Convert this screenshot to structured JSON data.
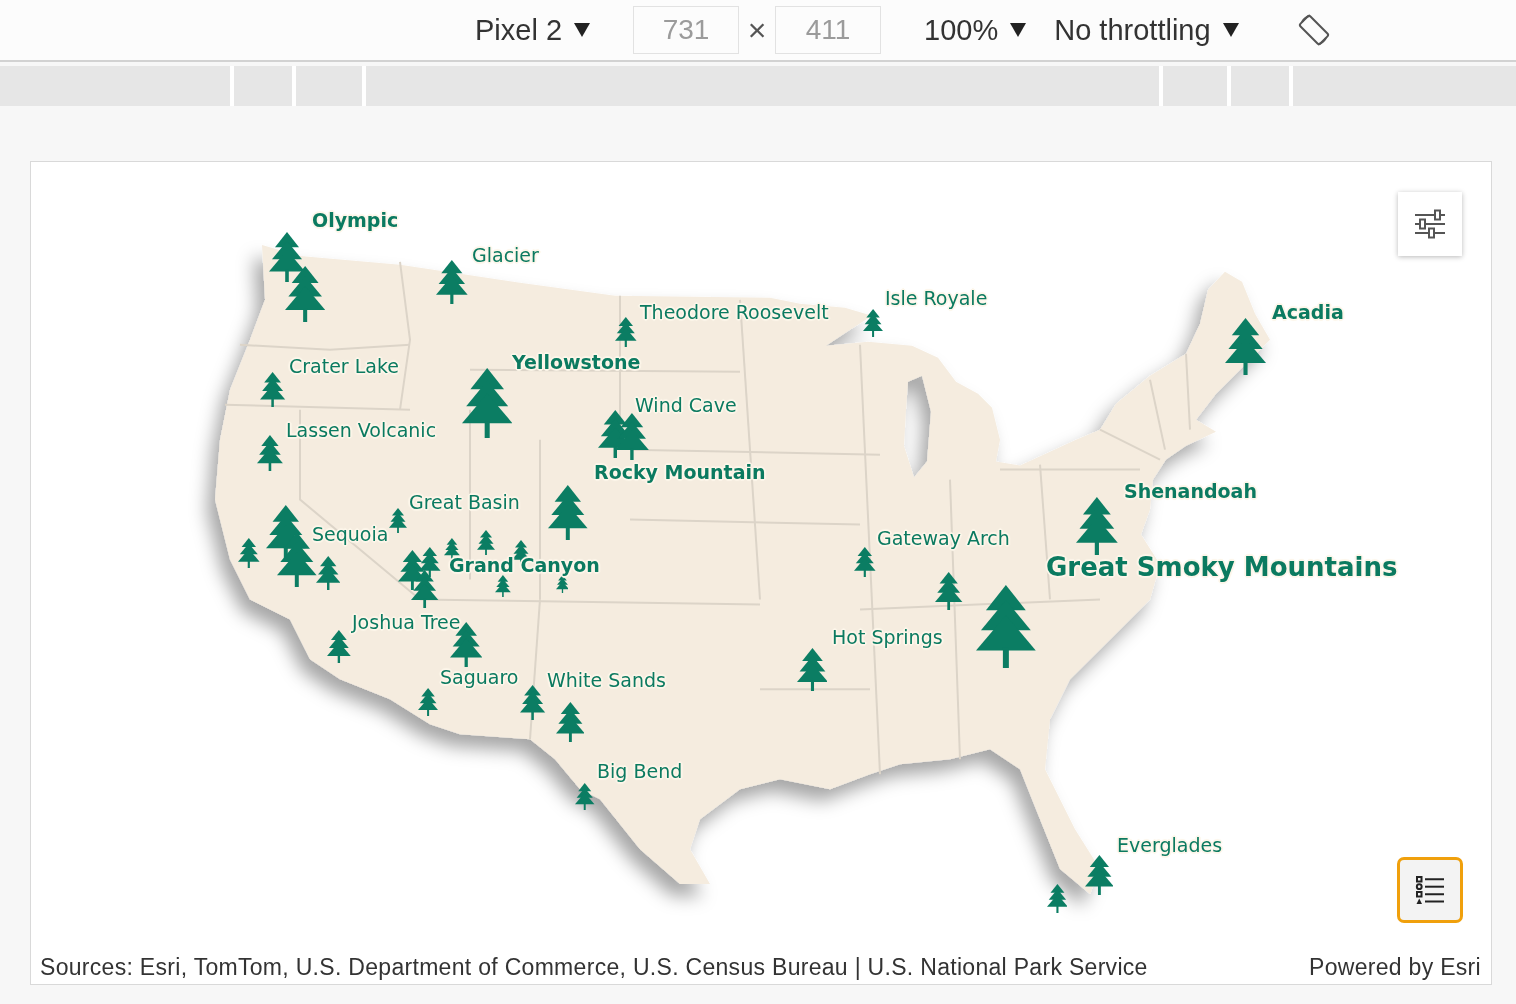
{
  "device_toolbar": {
    "device": "Pixel 2",
    "width": {
      "value": "731",
      "disabled": true
    },
    "separator": "×",
    "height": {
      "value": "411",
      "disabled": true
    },
    "zoom": "100%",
    "throttling": "No throttling"
  },
  "map": {
    "labels": [
      {
        "name": "Olympic",
        "kind": "major"
      },
      {
        "name": "Glacier",
        "kind": "minor"
      },
      {
        "name": "Isle Royale",
        "kind": "minor"
      },
      {
        "name": "Theodore Roosevelt",
        "kind": "minor"
      },
      {
        "name": "Acadia",
        "kind": "major"
      },
      {
        "name": "Yellowstone",
        "kind": "major"
      },
      {
        "name": "Crater Lake",
        "kind": "minor"
      },
      {
        "name": "Wind Cave",
        "kind": "minor"
      },
      {
        "name": "Lassen Volcanic",
        "kind": "minor"
      },
      {
        "name": "Rocky Mountain",
        "kind": "major"
      },
      {
        "name": "Shenandoah",
        "kind": "major"
      },
      {
        "name": "Great Basin",
        "kind": "minor"
      },
      {
        "name": "Sequoia",
        "kind": "minor"
      },
      {
        "name": "Gateway Arch",
        "kind": "minor"
      },
      {
        "name": "Grand Canyon",
        "kind": "major"
      },
      {
        "name": "Great Smoky Mountains",
        "kind": "top"
      },
      {
        "name": "Joshua Tree",
        "kind": "minor"
      },
      {
        "name": "Hot Springs",
        "kind": "minor"
      },
      {
        "name": "Saguaro",
        "kind": "minor"
      },
      {
        "name": "White Sands",
        "kind": "minor"
      },
      {
        "name": "Big Bend",
        "kind": "minor"
      },
      {
        "name": "Everglades",
        "kind": "minor"
      }
    ],
    "legend_button": {
      "focused": true
    },
    "attribution": {
      "sources": "Sources: Esri, TomTom, U.S. Department of Commerce, U.S. Census Bureau | U.S. National Park Service",
      "powered_by": "Powered by Esri"
    }
  }
}
